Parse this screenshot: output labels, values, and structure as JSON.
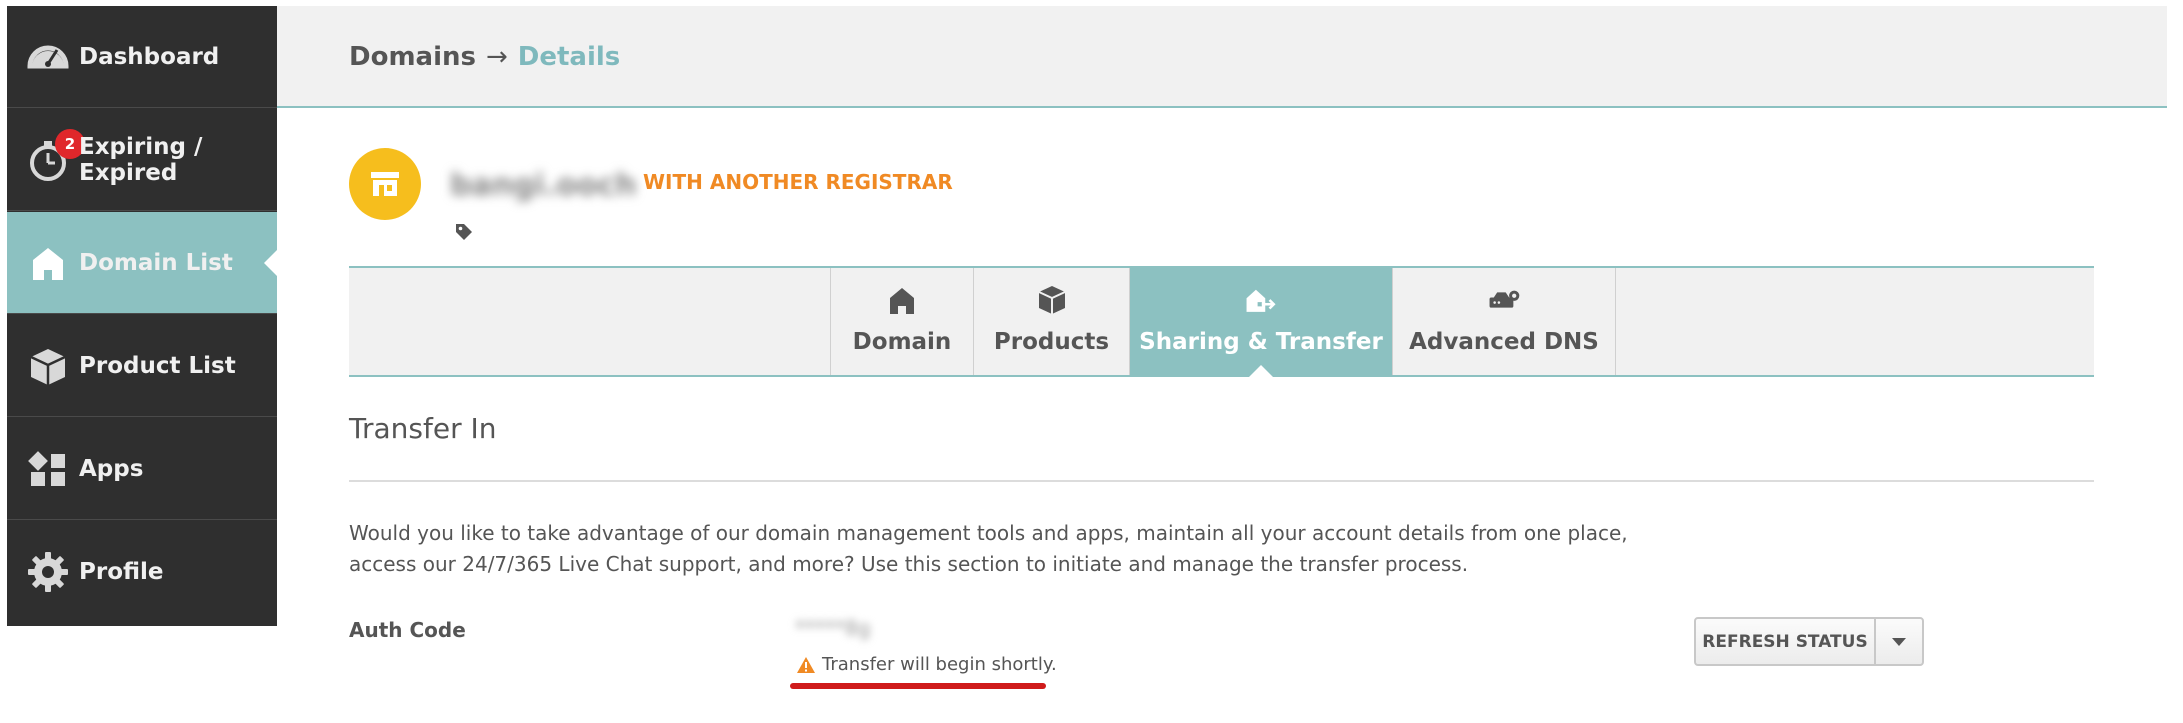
{
  "sidebar": {
    "items": [
      {
        "label": "Dashboard",
        "icon": "dashboard-gauge-icon"
      },
      {
        "label": "Expiring / Expired",
        "icon": "stopwatch-icon",
        "badge": "2"
      },
      {
        "label": "Domain List",
        "icon": "home-icon",
        "active": true
      },
      {
        "label": "Product List",
        "icon": "box-icon"
      },
      {
        "label": "Apps",
        "icon": "apps-grid-icon"
      },
      {
        "label": "Profile",
        "icon": "gear-icon"
      }
    ]
  },
  "header": {
    "breadcrumb": {
      "parent": "Domains",
      "separator": "→",
      "current": "Details"
    }
  },
  "domain": {
    "name": "bangi.ooch",
    "status": "WITH ANOTHER REGISTRAR"
  },
  "tabs": [
    {
      "label": "Domain",
      "icon": "home-icon"
    },
    {
      "label": "Products",
      "icon": "box-icon"
    },
    {
      "label": "Sharing & Transfer",
      "icon": "transfer-house-icon",
      "active": true
    },
    {
      "label": "Advanced DNS",
      "icon": "dns-server-icon"
    }
  ],
  "transfer_in": {
    "title": "Transfer In",
    "description": "Would you like to take advantage of our domain management tools and apps, maintain all your account details from one place, access our 24/7/365 Live Chat support, and more? Use this section to initiate and manage the transfer process.",
    "auth_label": "Auth Code",
    "auth_value": "*****8g",
    "message": "Transfer will begin shortly.",
    "refresh_label": "REFRESH STATUS"
  },
  "colors": {
    "sidebar_bg": "#2f2f2f",
    "accent_teal": "#8cc1c1",
    "status_orange": "#f08a24",
    "domain_badge": "#f6be1d",
    "badge_red": "#e0272b"
  }
}
